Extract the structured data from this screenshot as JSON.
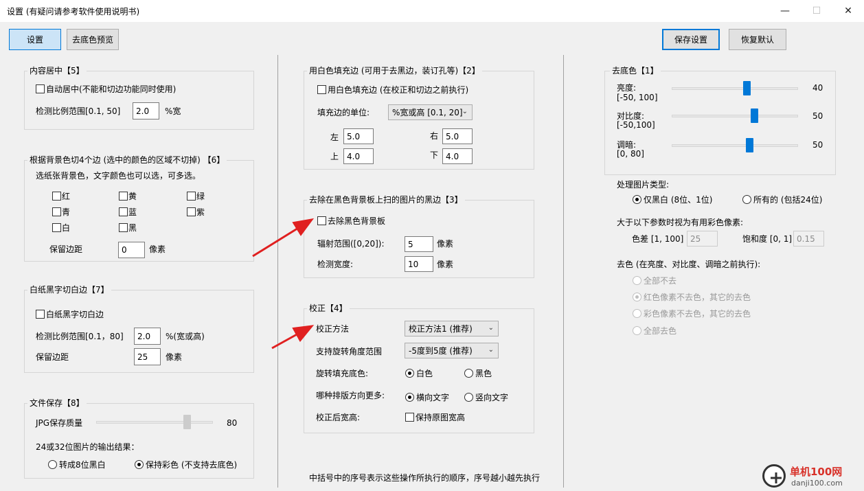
{
  "window": {
    "title": "设置 (有疑问请参考软件使用说明书)",
    "minimize": "—",
    "maximize": "☐",
    "close": "✕"
  },
  "toolbar": {
    "settings_tab": "设置",
    "preview_tab": "去底色预览",
    "save_button": "保存设置",
    "restore_button": "恢复默认"
  },
  "center_content": {
    "title": "内容居中【5】",
    "auto_center": "自动居中(不能和切边功能同时使用)",
    "ratio_label": "检测比例范围[0.1, 50]",
    "ratio_value": "2.0",
    "ratio_unit": "%宽"
  },
  "bg_cut": {
    "title": "根据背景色切4个边 (选中的颜色的区域不切掉) 【6】",
    "desc": "选纸张背景色，文字颜色也可以选，可多选。",
    "colors": [
      "红",
      "黄",
      "绿",
      "青",
      "蓝",
      "紫",
      "白",
      "黑"
    ],
    "margin_label": "保留边距",
    "margin_value": "0",
    "margin_unit": "像素"
  },
  "white_cut": {
    "title": "白纸黑字切白边【7】",
    "checkbox": "白纸黑字切白边",
    "ratio_label": "检测比例范围[0.1，80]",
    "ratio_value": "2.0",
    "ratio_unit": "%(宽或高)",
    "margin_label": "保留边距",
    "margin_value": "25",
    "margin_unit": "像素"
  },
  "file_save": {
    "title": "文件保存【8】",
    "jpg_label": "JPG保存质量",
    "jpg_value": "80",
    "jpg_level": 80,
    "output_label": "24或32位图片的输出结果：",
    "opt_bw": "转成8位黑白",
    "opt_color": "保持彩色 (不支持去底色)"
  },
  "white_fill": {
    "title": "用白色填充边 (可用于去黑边，装订孔等)【2】",
    "checkbox": "用白色填充边 (在校正和切边之前执行)",
    "unit_label": "填充边的单位:",
    "unit_value": "%宽或高 [0.1, 20]",
    "left_label": "左",
    "left_value": "5.0",
    "right_label": "右",
    "right_value": "5.0",
    "top_label": "上",
    "top_value": "4.0",
    "bottom_label": "下",
    "bottom_value": "4.0"
  },
  "black_bg": {
    "title": "去除在黑色背景板上扫的图片的黑边【3】",
    "checkbox": "去除黑色背景板",
    "radius_label": "辐射范围([0,20]):",
    "radius_value": "5",
    "radius_unit": "像素",
    "width_label": "检测宽度:",
    "width_value": "10",
    "width_unit": "像素"
  },
  "correction": {
    "title": "校正【4】",
    "method_label": "校正方法",
    "method_value": "校正方法1 (推荐)",
    "angle_label": "支持旋转角度范围",
    "angle_value": "-5度到5度 (推荐)",
    "fill_label": "旋转填充底色:",
    "fill_white": "白色",
    "fill_black": "黑色",
    "direction_label": "哪种排版方向更多:",
    "dir_h": "横向文字",
    "dir_v": "竖向文字",
    "size_label": "校正后宽高:",
    "keep_size": "保持原图宽高"
  },
  "footer_note": "中括号中的序号表示这些操作所执行的顺序，序号越小越先执行",
  "remove_bg": {
    "title": "去底色【1】",
    "brightness_label": "亮度:",
    "brightness_range": "[-50, 100]",
    "brightness_value": "40",
    "contrast_label": "对比度:",
    "contrast_range": "[-50,100]",
    "contrast_value": "50",
    "dark_label": "调暗:",
    "dark_range": "[0, 80]",
    "dark_value": "50",
    "type_label": "处理图片类型:",
    "type_bw": "仅黑白 (8位、1位)",
    "type_all": "所有的 (包括24位)",
    "color_px_label": "大于以下参数时视为有用彩色像素:",
    "diff_label": "色差 [1, 100]",
    "diff_value": "25",
    "sat_label": "饱和度 [0, 1]",
    "sat_value": "0.15",
    "decolor_label": "去色 (在亮度、对比度、调暗之前执行):",
    "decolor_opts": [
      "全部不去",
      "红色像素不去色，其它的去色",
      "彩色像素不去色，其它的去色",
      "全部去色"
    ]
  },
  "watermark": {
    "name": "单机100网",
    "url": "danji100.com"
  },
  "colors": {
    "accent": "#0078d7",
    "arrow": "#e02020"
  }
}
